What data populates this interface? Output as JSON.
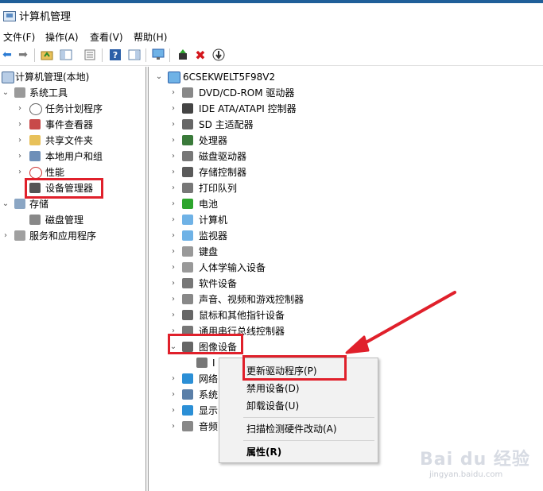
{
  "window": {
    "title": "计算机管理"
  },
  "menubar": [
    "文件(F)",
    "操作(A)",
    "查看(V)",
    "帮助(H)"
  ],
  "toolbar": {
    "icons": [
      "back-icon",
      "forward-icon",
      "up-folder-icon",
      "show-tree-icon",
      "properties-icon",
      "help-icon",
      "action-pane-icon",
      "monitor-icon",
      "update-driver-icon",
      "uninstall-icon",
      "disable-icon"
    ]
  },
  "left_tree": {
    "root": "计算机管理(本地)",
    "system_tools": "系统工具",
    "system_items": [
      "任务计划程序",
      "事件查看器",
      "共享文件夹",
      "本地用户和组",
      "性能",
      "设备管理器"
    ],
    "storage": "存储",
    "storage_items": [
      "磁盘管理"
    ],
    "services": "服务和应用程序"
  },
  "device_tree": {
    "root": "6CSEKWELT5F98V2",
    "categories": [
      "DVD/CD-ROM 驱动器",
      "IDE ATA/ATAPI 控制器",
      "SD 主适配器",
      "处理器",
      "磁盘驱动器",
      "存储控制器",
      "打印队列",
      "电池",
      "计算机",
      "监视器",
      "键盘",
      "人体学输入设备",
      "软件设备",
      "声音、视频和游戏控制器",
      "鼠标和其他指针设备",
      "通用串行总线控制器",
      "图像设备"
    ],
    "image_child": "I",
    "after": [
      "网络",
      "系统",
      "显示",
      "音频"
    ]
  },
  "context_menu": {
    "items": [
      "更新驱动程序(P)",
      "禁用设备(D)",
      "卸载设备(U)",
      "扫描检测硬件改动(A)",
      "属性(R)"
    ]
  },
  "watermark": {
    "main": "Bai du 经验",
    "sub": "jingyan.baidu.com"
  },
  "colors": {
    "highlight_box": "#e0202b",
    "arrow": "#e0202b",
    "title_strip": "#1f5f99"
  }
}
